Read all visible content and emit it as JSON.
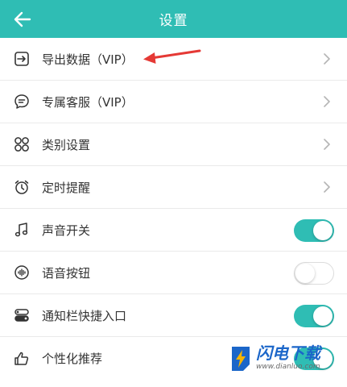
{
  "header": {
    "title": "设置",
    "back_icon": "arrow-left-icon",
    "bg_color": "#2fbdb4"
  },
  "rows": [
    {
      "label": "导出数据（VIP）",
      "icon": "export-icon",
      "control": "chevron"
    },
    {
      "label": "专属客服（VIP）",
      "icon": "chat-bubble-icon",
      "control": "chevron"
    },
    {
      "label": "类别设置",
      "icon": "category-grid-icon",
      "control": "chevron"
    },
    {
      "label": "定时提醒",
      "icon": "alarm-clock-icon",
      "control": "chevron"
    },
    {
      "label": "声音开关",
      "icon": "music-note-icon",
      "control": "toggle",
      "on": true
    },
    {
      "label": "语音按钮",
      "icon": "voice-wave-icon",
      "control": "toggle",
      "on": false
    },
    {
      "label": "通知栏快捷入口",
      "icon": "notification-bar-icon",
      "control": "toggle",
      "on": true
    },
    {
      "label": "个性化推荐",
      "icon": "thumbs-up-icon",
      "control": "toggle",
      "on": true
    }
  ],
  "annotation": {
    "type": "red-arrow",
    "color": "#e53935",
    "points_to": "导出数据（VIP）"
  },
  "watermark": {
    "brand": "闪电下载",
    "url": "www.dianluo.com"
  },
  "colors": {
    "accent": "#2fbdb4",
    "toggle_off_border": "#dcdcdc",
    "divider": "#eaeaea"
  }
}
